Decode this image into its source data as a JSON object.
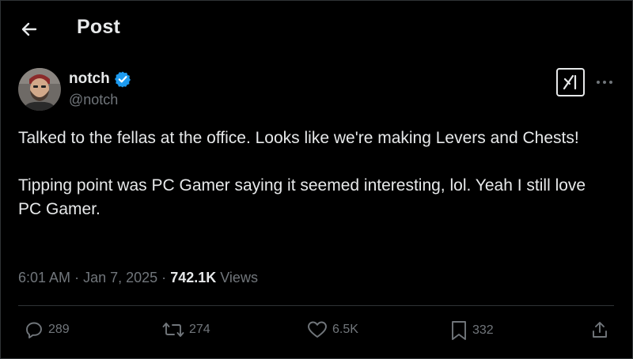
{
  "header": {
    "title": "Post"
  },
  "author": {
    "display_name": "notch",
    "handle": "@notch",
    "verified": true
  },
  "post": {
    "paragraphs": [
      "Talked to the fellas at the office.  Looks like we're making Levers and Chests!",
      "Tipping point was PC Gamer saying it seemed interesting, lol. Yeah I still love PC Gamer."
    ],
    "time": "6:01 AM",
    "date": "Jan 7, 2025",
    "separator": "·",
    "views_count": "742.1K",
    "views_label": "Views"
  },
  "actions": {
    "replies": "289",
    "reposts": "274",
    "likes": "6.5K",
    "bookmarks": "332"
  },
  "icons": {
    "back": "arrow-left-icon",
    "verified": "verified-badge-icon",
    "grok": "grok-icon",
    "more": "more-horizontal-icon",
    "reply": "reply-icon",
    "repost": "repost-icon",
    "like": "heart-icon",
    "bookmark": "bookmark-icon",
    "share": "share-icon"
  },
  "colors": {
    "background": "#000000",
    "text": "#e7e9ea",
    "muted": "#71767b",
    "border": "#2f3336",
    "verified": "#1d9bf0"
  }
}
